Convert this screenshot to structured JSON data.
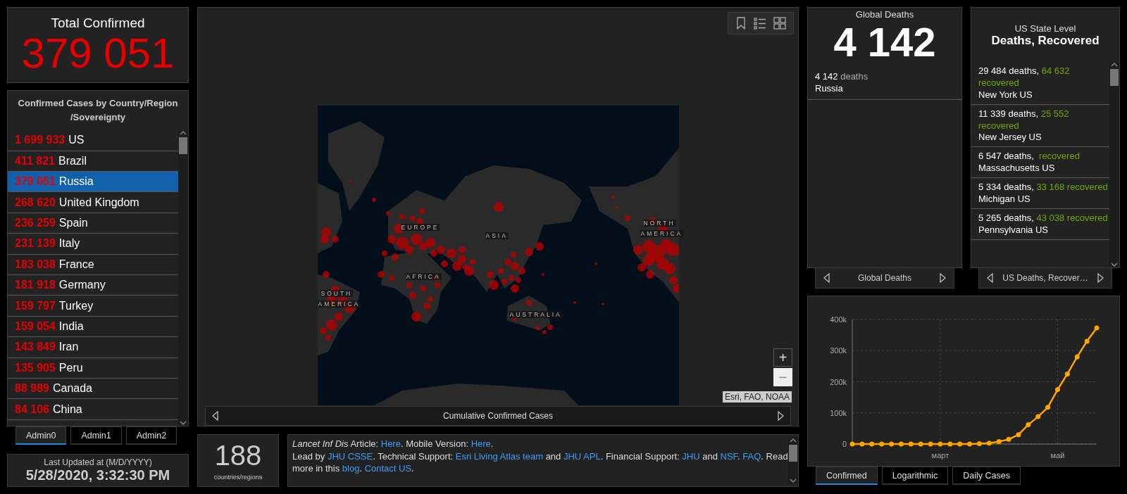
{
  "total_confirmed": {
    "title": "Total Confirmed",
    "value": "379 051"
  },
  "country_list": {
    "title": "Confirmed Cases by Country/Region /Sovereignty",
    "rows": [
      {
        "count": "1 699 933",
        "name": "US",
        "selected": false
      },
      {
        "count": "411 821",
        "name": "Brazil",
        "selected": false
      },
      {
        "count": "379 051",
        "name": "Russia",
        "selected": true
      },
      {
        "count": "268 620",
        "name": "United Kingdom",
        "selected": false
      },
      {
        "count": "236 259",
        "name": "Spain",
        "selected": false
      },
      {
        "count": "231 139",
        "name": "Italy",
        "selected": false
      },
      {
        "count": "183 038",
        "name": "France",
        "selected": false
      },
      {
        "count": "181 918",
        "name": "Germany",
        "selected": false
      },
      {
        "count": "159 797",
        "name": "Turkey",
        "selected": false
      },
      {
        "count": "159 054",
        "name": "India",
        "selected": false
      },
      {
        "count": "143 849",
        "name": "Iran",
        "selected": false
      },
      {
        "count": "135 905",
        "name": "Peru",
        "selected": false
      },
      {
        "count": "88 989",
        "name": "Canada",
        "selected": false
      },
      {
        "count": "84 106",
        "name": "China",
        "selected": false
      }
    ]
  },
  "admin_tabs": [
    {
      "label": "Admin0",
      "selected": true
    },
    {
      "label": "Admin1",
      "selected": false
    },
    {
      "label": "Admin2",
      "selected": false
    }
  ],
  "last_updated": {
    "label": "Last Updated at (M/D/YYYY)",
    "value": "5/28/2020, 3:32:30 PM"
  },
  "map": {
    "labels": [
      "EUROPE",
      "ASIA",
      "AFRICA",
      "SOUTH",
      "AMERICA",
      "NORTH",
      "AMERICA",
      "AUSTRALIA"
    ],
    "zoom_in": "+",
    "zoom_out": "−",
    "attribution": "Esri, FAO, NOAA",
    "footer": "Cumulative Confirmed Cases"
  },
  "country_count": {
    "value": "188",
    "label": "countries/regions"
  },
  "credits": {
    "paragraphs": [
      [
        {
          "kind": "italic",
          "text": "Lancet Inf Dis"
        },
        {
          "kind": "text",
          "text": " Article: "
        },
        {
          "kind": "link",
          "text": "Here"
        },
        {
          "kind": "text",
          "text": ". Mobile Version: "
        },
        {
          "kind": "link",
          "text": "Here"
        },
        {
          "kind": "text",
          "text": "."
        }
      ],
      [
        {
          "kind": "text",
          "text": "Lead by "
        },
        {
          "kind": "link",
          "text": "JHU CSSE"
        },
        {
          "kind": "text",
          "text": ". Technical Support: "
        },
        {
          "kind": "link",
          "text": "Esri Living Atlas team"
        },
        {
          "kind": "text",
          "text": " and "
        },
        {
          "kind": "link",
          "text": "JHU APL"
        },
        {
          "kind": "text",
          "text": ". Financial Support: "
        },
        {
          "kind": "link",
          "text": "JHU"
        },
        {
          "kind": "text",
          "text": " and "
        },
        {
          "kind": "link",
          "text": "NSF"
        },
        {
          "kind": "text",
          "text": ". "
        },
        {
          "kind": "link",
          "text": "FAQ"
        },
        {
          "kind": "text",
          "text": ". Read more in this "
        },
        {
          "kind": "link",
          "text": "blog"
        },
        {
          "kind": "text",
          "text": ". "
        },
        {
          "kind": "link",
          "text": "Contact US"
        },
        {
          "kind": "text",
          "text": "."
        }
      ]
    ]
  },
  "global_deaths": {
    "title": "Global Deaths",
    "value": "4 142",
    "items": [
      {
        "count": "4 142",
        "unit": "deaths",
        "place": "Russia"
      }
    ],
    "footer": "Global Deaths"
  },
  "us_state": {
    "subtitle": "US State Level",
    "title": "Deaths, Recovered",
    "items": [
      {
        "deaths": "29 484 deaths,",
        "recovered_count": "64 632",
        "recovered_label": "recovered",
        "place": "New York US"
      },
      {
        "deaths": "11 339 deaths,",
        "recovered_count": "25 552",
        "recovered_label": "recovered",
        "place": "New Jersey US"
      },
      {
        "deaths": "6 547 deaths,",
        "recovered_label": "recovered",
        "place": "Massachusetts US"
      },
      {
        "deaths": "5 334 deaths,",
        "recovered_count": "33 168",
        "recovered_label": "recovered",
        "place": "Michigan US"
      },
      {
        "deaths": "5 265 deaths,",
        "recovered_count": "43 038",
        "recovered_label": "recovered",
        "place": "Pennsylvania US"
      }
    ],
    "footer": "US Deaths, Recover…"
  },
  "cases_chart": {
    "chart_data": {
      "type": "line",
      "categories": [
        null,
        null,
        null,
        null,
        null,
        null,
        null,
        null,
        null,
        "март",
        null,
        null,
        null,
        null,
        null,
        null,
        null,
        null,
        null,
        null,
        null,
        "май",
        null,
        null,
        null,
        null
      ],
      "series": [
        {
          "color": "#ffa500",
          "marker": "circle",
          "values": [
            0,
            0,
            0,
            0,
            0,
            0,
            0,
            0,
            0,
            0,
            0,
            0,
            0,
            1000,
            3000,
            8000,
            15000,
            30000,
            62000,
            88000,
            118000,
            175000,
            225000,
            280000,
            330000,
            373000
          ]
        }
      ],
      "grid": true,
      "ylim": [
        0,
        400000
      ],
      "yticks": [
        {
          "value": 0,
          "label": "0"
        },
        {
          "value": 100000,
          "label": "100k"
        },
        {
          "value": 200000,
          "label": "200k"
        },
        {
          "value": 300000,
          "label": "300k"
        },
        {
          "value": 400000,
          "label": "400k"
        }
      ]
    },
    "tabs": [
      {
        "label": "Confirmed",
        "selected": true
      },
      {
        "label": "Logarithmic",
        "selected": false
      },
      {
        "label": "Daily Cases",
        "selected": false
      }
    ]
  }
}
